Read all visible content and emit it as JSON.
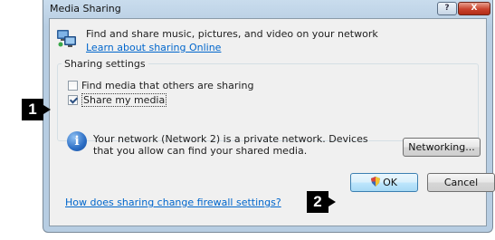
{
  "window": {
    "title": "Media Sharing",
    "help_label": "?",
    "close_label": "X"
  },
  "header": {
    "description": "Find and share music, pictures, and video on your network",
    "learn_link": "Learn about sharing Online"
  },
  "sharing": {
    "group_title": "Sharing settings",
    "options": [
      {
        "label": "Find media that others are sharing",
        "checked": false
      },
      {
        "label": "Share my media",
        "checked": true
      }
    ]
  },
  "network": {
    "info_icon": "i",
    "message": "Your network (Network  2) is a private network. Devices that you allow can find your shared media.",
    "networking_button": "Networking..."
  },
  "footer": {
    "firewall_link": "How does sharing change firewall settings?",
    "ok_label": "OK",
    "cancel_label": "Cancel"
  },
  "markers": {
    "first": "1",
    "second": "2"
  }
}
